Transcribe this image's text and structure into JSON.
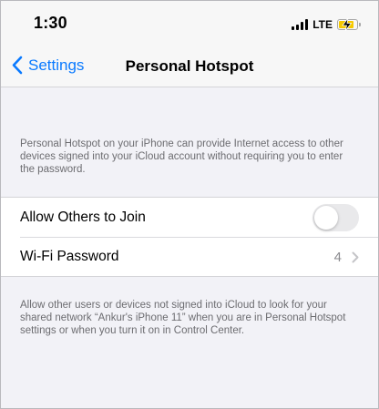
{
  "status_bar": {
    "time": "1:30",
    "network": "LTE",
    "signal_icon": "signal-bars-icon",
    "battery_icon": "battery-charging-icon",
    "battery_color": "#f5c900"
  },
  "nav": {
    "back_label": "Settings",
    "back_icon": "chevron-left-icon",
    "title": "Personal Hotspot",
    "accent": "#0a7aff"
  },
  "intro_text": "Personal Hotspot on your iPhone can provide Internet access to other devices signed into your iCloud account without requiring you to enter the password.",
  "settings": {
    "allow_others": {
      "label": "Allow Others to Join",
      "enabled": false
    },
    "wifi_password": {
      "label": "Wi-Fi Password",
      "value": "4",
      "icon": "chevron-right-icon"
    }
  },
  "footer_text": "Allow other users or devices not signed into iCloud to look for your shared network “Ankur's iPhone 11” when you are in Personal Hotspot settings or when you turn it on in Control Center."
}
